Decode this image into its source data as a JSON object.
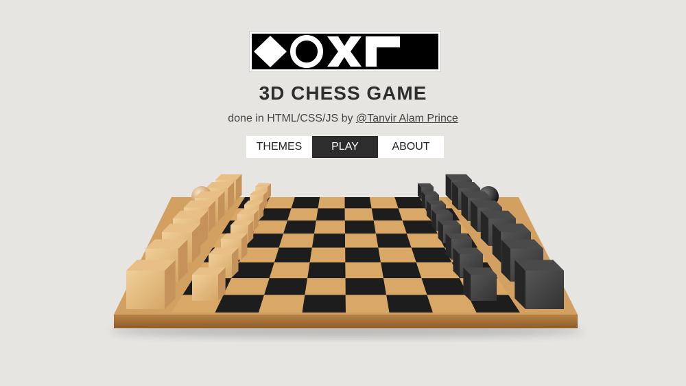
{
  "logo": {
    "name": "game-logo",
    "colors": {
      "background": "#000000",
      "foreground": "#ffffff"
    }
  },
  "header": {
    "title": "3D CHESS GAME",
    "subtitle_prefix": "done in HTML/CSS/JS by ",
    "author_link": "@Tanvir Alam Prince"
  },
  "menu": {
    "items": [
      {
        "label": "THEMES",
        "active": false
      },
      {
        "label": "PLAY",
        "active": true
      },
      {
        "label": "ABOUT",
        "active": false
      }
    ]
  },
  "board": {
    "light_square_color": "#d9a866",
    "dark_square_color": "#1d1d1d",
    "frame_color": "#c89a5c",
    "light_piece_color": "#e8bf86",
    "dark_piece_color": "#3a3a3a",
    "rows": 8,
    "cols": 8
  }
}
